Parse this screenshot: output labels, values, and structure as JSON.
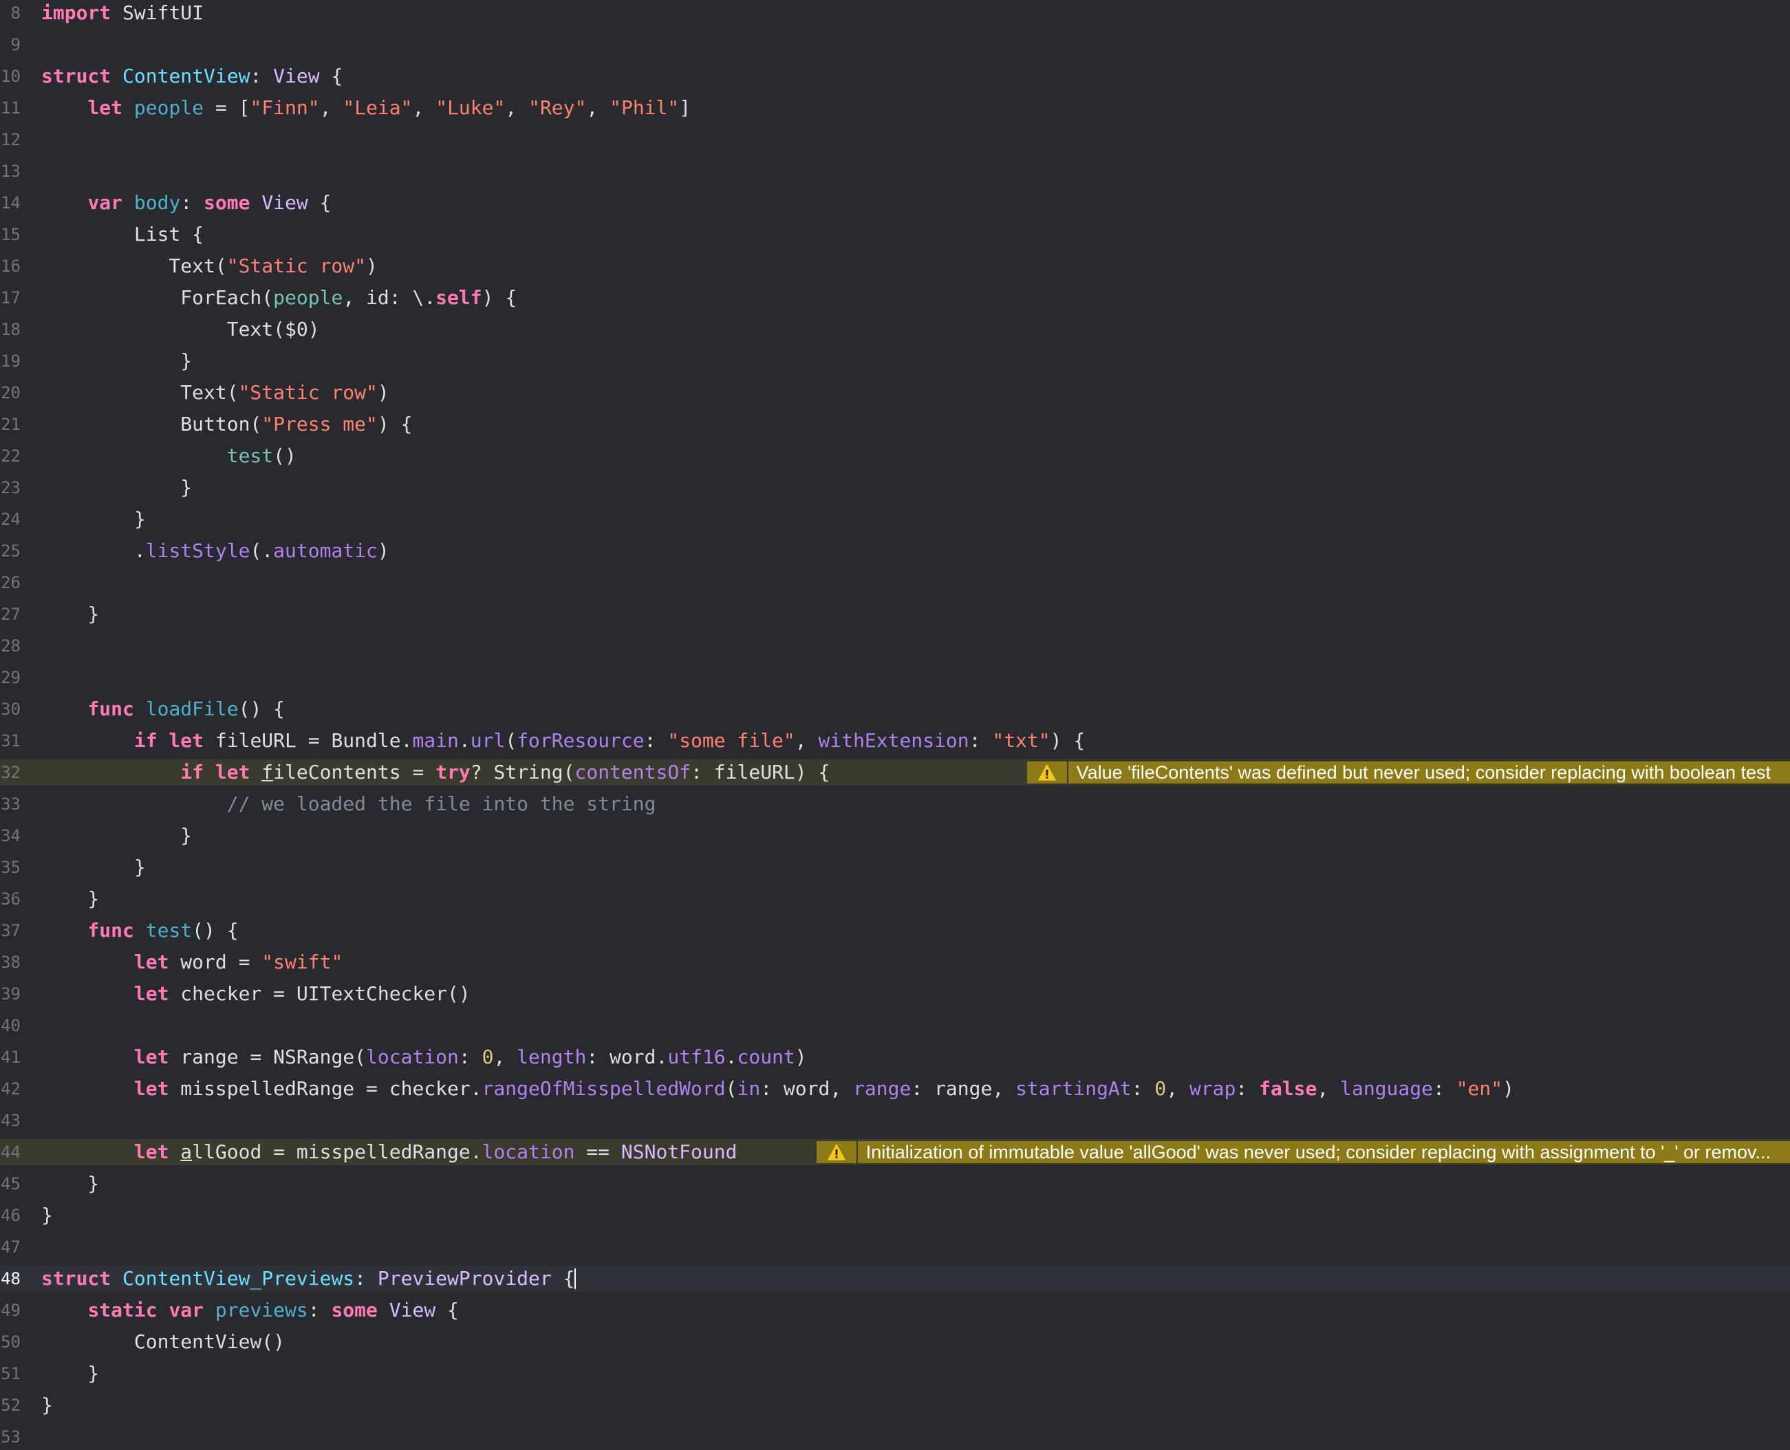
{
  "editor": {
    "language": "Swift",
    "warnings": {
      "line32": "Value 'fileContents' was defined but never used; consider replacing with boolean test",
      "line44": "Initialization of immutable value 'allGood' was never used; consider replacing with assignment to '_' or remov..."
    },
    "lines": [
      {
        "n": "8",
        "tokens": [
          [
            "kw",
            "import"
          ],
          [
            "p",
            " SwiftUI"
          ]
        ]
      },
      {
        "n": "9",
        "tokens": []
      },
      {
        "n": "10",
        "tokens": [
          [
            "kw",
            "struct"
          ],
          [
            "p",
            " "
          ],
          [
            "decl",
            "ContentView"
          ],
          [
            "p",
            ": "
          ],
          [
            "type",
            "View"
          ],
          [
            "p",
            " {"
          ]
        ]
      },
      {
        "n": "11",
        "tokens": [
          [
            "p",
            "    "
          ],
          [
            "kw",
            "let"
          ],
          [
            "p",
            " "
          ],
          [
            "decl2",
            "people"
          ],
          [
            "p",
            " = ["
          ],
          [
            "str",
            "\"Finn\""
          ],
          [
            "p",
            ", "
          ],
          [
            "str",
            "\"Leia\""
          ],
          [
            "p",
            ", "
          ],
          [
            "str",
            "\"Luke\""
          ],
          [
            "p",
            ", "
          ],
          [
            "str",
            "\"Rey\""
          ],
          [
            "p",
            ", "
          ],
          [
            "str",
            "\"Phil\""
          ],
          [
            "p",
            "]"
          ]
        ]
      },
      {
        "n": "12",
        "tokens": []
      },
      {
        "n": "13",
        "tokens": []
      },
      {
        "n": "14",
        "tokens": [
          [
            "p",
            "    "
          ],
          [
            "kw",
            "var"
          ],
          [
            "p",
            " "
          ],
          [
            "decl2",
            "body"
          ],
          [
            "p",
            ": "
          ],
          [
            "kw",
            "some"
          ],
          [
            "p",
            " "
          ],
          [
            "type",
            "View"
          ],
          [
            "p",
            " {"
          ]
        ]
      },
      {
        "n": "15",
        "tokens": [
          [
            "p",
            "        List {"
          ]
        ]
      },
      {
        "n": "16",
        "tokens": [
          [
            "p",
            "           Text("
          ],
          [
            "str",
            "\"Static row\""
          ],
          [
            "p",
            ")"
          ]
        ]
      },
      {
        "n": "17",
        "tokens": [
          [
            "p",
            "            ForEach("
          ],
          [
            "local",
            "people"
          ],
          [
            "p",
            ", id: \\."
          ],
          [
            "kw",
            "self"
          ],
          [
            "p",
            ") {"
          ]
        ]
      },
      {
        "n": "18",
        "tokens": [
          [
            "p",
            "                Text($0)"
          ]
        ]
      },
      {
        "n": "19",
        "tokens": [
          [
            "p",
            "            }"
          ]
        ]
      },
      {
        "n": "20",
        "tokens": [
          [
            "p",
            "            Text("
          ],
          [
            "str",
            "\"Static row\""
          ],
          [
            "p",
            ")"
          ]
        ]
      },
      {
        "n": "21",
        "tokens": [
          [
            "p",
            "            Button("
          ],
          [
            "str",
            "\"Press me\""
          ],
          [
            "p",
            ") {"
          ]
        ]
      },
      {
        "n": "22",
        "tokens": [
          [
            "p",
            "                "
          ],
          [
            "local",
            "test"
          ],
          [
            "p",
            "()"
          ]
        ]
      },
      {
        "n": "23",
        "tokens": [
          [
            "p",
            "            }"
          ]
        ]
      },
      {
        "n": "24",
        "tokens": [
          [
            "p",
            "        }"
          ]
        ]
      },
      {
        "n": "25",
        "tokens": [
          [
            "p",
            "        ."
          ],
          [
            "fn",
            "listStyle"
          ],
          [
            "p",
            "(."
          ],
          [
            "fn",
            "automatic"
          ],
          [
            "p",
            ")"
          ]
        ]
      },
      {
        "n": "26",
        "tokens": []
      },
      {
        "n": "27",
        "tokens": [
          [
            "p",
            "    }"
          ]
        ]
      },
      {
        "n": "28",
        "tokens": []
      },
      {
        "n": "29",
        "tokens": []
      },
      {
        "n": "30",
        "tokens": [
          [
            "p",
            "    "
          ],
          [
            "kw",
            "func"
          ],
          [
            "p",
            " "
          ],
          [
            "decl2",
            "loadFile"
          ],
          [
            "p",
            "() {"
          ]
        ]
      },
      {
        "n": "31",
        "tokens": [
          [
            "p",
            "        "
          ],
          [
            "kw",
            "if let"
          ],
          [
            "p",
            " fileURL = Bundle."
          ],
          [
            "fn",
            "main"
          ],
          [
            "p",
            "."
          ],
          [
            "fn",
            "url"
          ],
          [
            "p",
            "("
          ],
          [
            "fn",
            "forResource"
          ],
          [
            "p",
            ": "
          ],
          [
            "str",
            "\"some file\""
          ],
          [
            "p",
            ", "
          ],
          [
            "fn",
            "withExtension"
          ],
          [
            "p",
            ": "
          ],
          [
            "str",
            "\"txt\""
          ],
          [
            "p",
            ") {"
          ]
        ]
      },
      {
        "n": "32",
        "tokens": [
          [
            "p",
            "            "
          ],
          [
            "kw",
            "if let"
          ],
          [
            "p",
            " "
          ],
          [
            "u",
            "f"
          ],
          [
            "p",
            "ileContents = "
          ],
          [
            "kw",
            "try"
          ],
          [
            "p",
            "? String("
          ],
          [
            "fn",
            "contentsOf"
          ],
          [
            "p",
            ": fileURL) {"
          ]
        ]
      },
      {
        "n": "33",
        "tokens": [
          [
            "p",
            "                "
          ],
          [
            "cmt",
            "// we loaded the file into the string"
          ]
        ]
      },
      {
        "n": "34",
        "tokens": [
          [
            "p",
            "            }"
          ]
        ]
      },
      {
        "n": "35",
        "tokens": [
          [
            "p",
            "        }"
          ]
        ]
      },
      {
        "n": "36",
        "tokens": [
          [
            "p",
            "    }"
          ]
        ]
      },
      {
        "n": "37",
        "tokens": [
          [
            "p",
            "    "
          ],
          [
            "kw",
            "func"
          ],
          [
            "p",
            " "
          ],
          [
            "decl2",
            "test"
          ],
          [
            "p",
            "() {"
          ]
        ]
      },
      {
        "n": "38",
        "tokens": [
          [
            "p",
            "        "
          ],
          [
            "kw",
            "let"
          ],
          [
            "p",
            " word = "
          ],
          [
            "str",
            "\"swift\""
          ]
        ]
      },
      {
        "n": "39",
        "tokens": [
          [
            "p",
            "        "
          ],
          [
            "kw",
            "let"
          ],
          [
            "p",
            " checker = UITextChecker()"
          ]
        ]
      },
      {
        "n": "40",
        "tokens": []
      },
      {
        "n": "41",
        "tokens": [
          [
            "p",
            "        "
          ],
          [
            "kw",
            "let"
          ],
          [
            "p",
            " range = NSRange("
          ],
          [
            "fn",
            "location"
          ],
          [
            "p",
            ": "
          ],
          [
            "num",
            "0"
          ],
          [
            "p",
            ", "
          ],
          [
            "fn",
            "length"
          ],
          [
            "p",
            ": word."
          ],
          [
            "fn",
            "utf16"
          ],
          [
            "p",
            "."
          ],
          [
            "fn",
            "count"
          ],
          [
            "p",
            ")"
          ]
        ]
      },
      {
        "n": "42",
        "tokens": [
          [
            "p",
            "        "
          ],
          [
            "kw",
            "let"
          ],
          [
            "p",
            " misspelledRange = checker."
          ],
          [
            "fn",
            "rangeOfMisspelledWord"
          ],
          [
            "p",
            "("
          ],
          [
            "fn",
            "in"
          ],
          [
            "p",
            ": word, "
          ],
          [
            "fn",
            "range"
          ],
          [
            "p",
            ": range, "
          ],
          [
            "fn",
            "startingAt"
          ],
          [
            "p",
            ": "
          ],
          [
            "num",
            "0"
          ],
          [
            "p",
            ", "
          ],
          [
            "fn",
            "wrap"
          ],
          [
            "p",
            ": "
          ],
          [
            "kw",
            "false"
          ],
          [
            "p",
            ", "
          ],
          [
            "fn",
            "language"
          ],
          [
            "p",
            ": "
          ],
          [
            "str",
            "\"en\""
          ],
          [
            "p",
            ")"
          ]
        ]
      },
      {
        "n": "43",
        "tokens": []
      },
      {
        "n": "44",
        "tokens": [
          [
            "p",
            "        "
          ],
          [
            "kw",
            "let"
          ],
          [
            "p",
            " "
          ],
          [
            "u",
            "a"
          ],
          [
            "p",
            "llGood = misspelledRange."
          ],
          [
            "fn",
            "location"
          ],
          [
            "p",
            " == "
          ],
          [
            "type",
            "NSNotFound"
          ]
        ]
      },
      {
        "n": "45",
        "tokens": [
          [
            "p",
            "    }"
          ]
        ]
      },
      {
        "n": "46",
        "tokens": [
          [
            "p",
            "}"
          ]
        ]
      },
      {
        "n": "47",
        "tokens": []
      },
      {
        "n": "48",
        "tokens": [
          [
            "kw",
            "struct"
          ],
          [
            "p",
            " "
          ],
          [
            "decl",
            "ContentView_Previews"
          ],
          [
            "p",
            ": "
          ],
          [
            "type",
            "PreviewProvider"
          ],
          [
            "p",
            " {"
          ],
          [
            "caret",
            ""
          ]
        ]
      },
      {
        "n": "49",
        "tokens": [
          [
            "p",
            "    "
          ],
          [
            "kw",
            "static var"
          ],
          [
            "p",
            " "
          ],
          [
            "decl2",
            "previews"
          ],
          [
            "p",
            ": "
          ],
          [
            "kw",
            "some"
          ],
          [
            "p",
            " "
          ],
          [
            "type",
            "View"
          ],
          [
            "p",
            " {"
          ]
        ]
      },
      {
        "n": "50",
        "tokens": [
          [
            "p",
            "        ContentView()"
          ]
        ]
      },
      {
        "n": "51",
        "tokens": [
          [
            "p",
            "    }"
          ]
        ]
      },
      {
        "n": "52",
        "tokens": [
          [
            "p",
            "}"
          ]
        ]
      },
      {
        "n": "53",
        "tokens": []
      }
    ]
  }
}
